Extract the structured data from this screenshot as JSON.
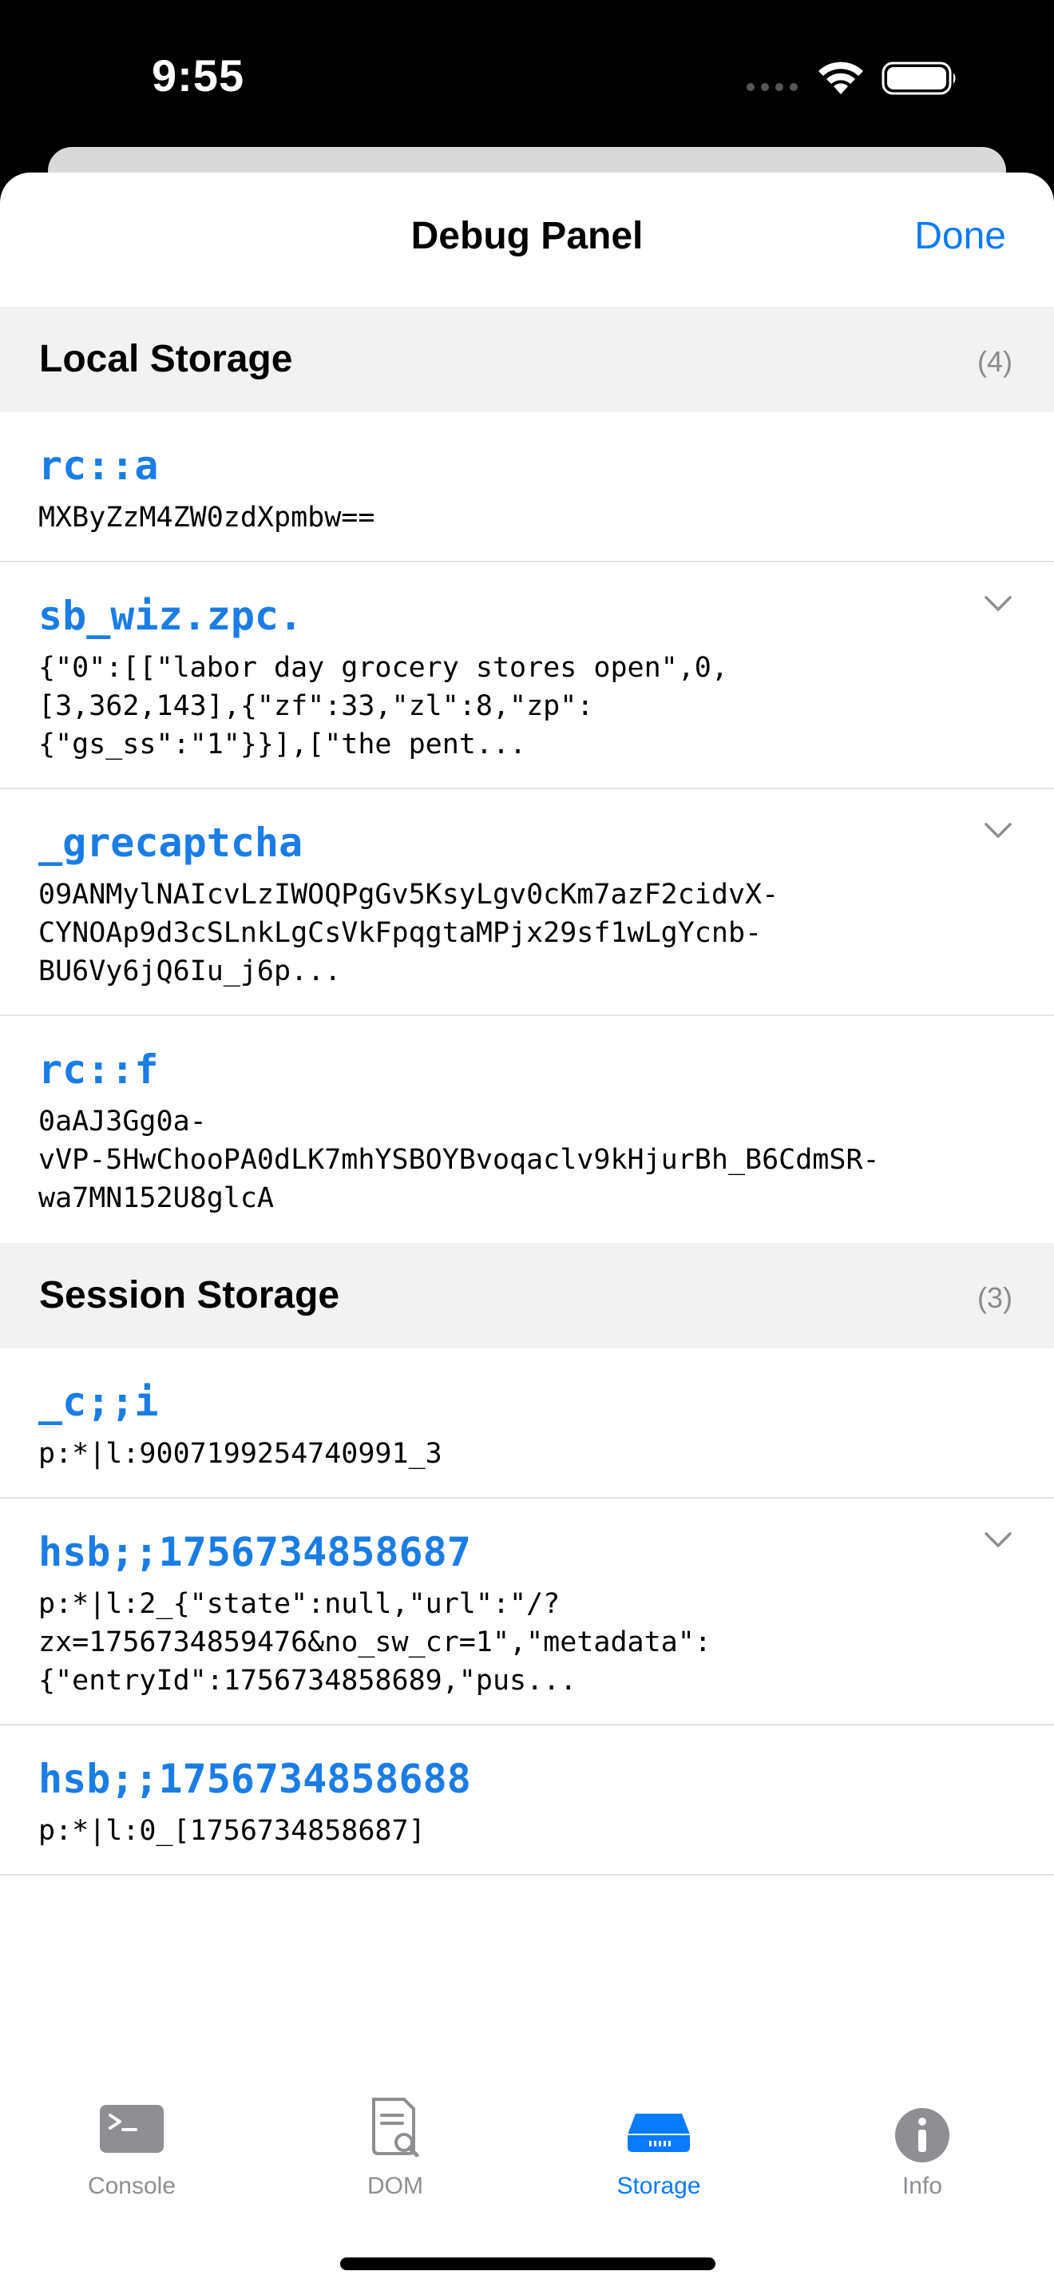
{
  "status_bar": {
    "time": "9:55"
  },
  "nav": {
    "title": "Debug Panel",
    "done_label": "Done"
  },
  "sections": [
    {
      "title": "Local Storage",
      "count": "(4)",
      "entries": [
        {
          "key": "rc::a",
          "value": "MXByZzM4ZW0zdXpmbw==",
          "expandable": false
        },
        {
          "key": "sb_wiz.zpc.",
          "value": "{\"0\":[[\"labor day grocery stores open\",0,\n[3,362,143],{\"zf\":33,\"zl\":8,\"zp\":\n{\"gs_ss\":\"1\"}}],[\"the pent...",
          "expandable": true
        },
        {
          "key": "_grecaptcha",
          "value": "09ANMylNAIcvLzIWOQPgGv5KsyLgv0cKm7azF2cidvX-\nCYNOAp9d3cSLnkLgCsVkFpqgtaMPjx29sf1wLgYcnb-\nBU6Vy6jQ6Iu_j6p...",
          "expandable": true
        },
        {
          "key": "rc::f",
          "value": "0aAJ3Gg0a-\nvVP-5HwChooPA0dLK7mhYSBOYBvoqaclv9kHjurBh_B6CdmSR-\nwa7MN152U8glcA",
          "expandable": false
        }
      ]
    },
    {
      "title": "Session Storage",
      "count": "(3)",
      "entries": [
        {
          "key": "_c;;i",
          "value": "p:*|l:9007199254740991_3",
          "expandable": false
        },
        {
          "key": "hsb;;1756734858687",
          "value": "p:*|l:2_{\"state\":null,\"url\":\"/?\nzx=1756734859476&no_sw_cr=1\",\"metadata\":\n{\"entryId\":1756734858689,\"pus...",
          "expandable": true
        },
        {
          "key": "hsb;;1756734858688",
          "value": "p:*|l:0_[1756734858687]",
          "expandable": false
        }
      ]
    }
  ],
  "tabs": [
    {
      "label": "Console",
      "icon": "terminal-icon",
      "active": false
    },
    {
      "label": "DOM",
      "icon": "document-search-icon",
      "active": false
    },
    {
      "label": "Storage",
      "icon": "storage-drive-icon",
      "active": true
    },
    {
      "label": "Info",
      "icon": "info-icon",
      "active": false
    }
  ],
  "colors": {
    "accent": "#0a7aff",
    "key_blue": "#1a7de6",
    "inactive_gray": "#8e8e93",
    "section_bg": "#f2f2f2"
  }
}
